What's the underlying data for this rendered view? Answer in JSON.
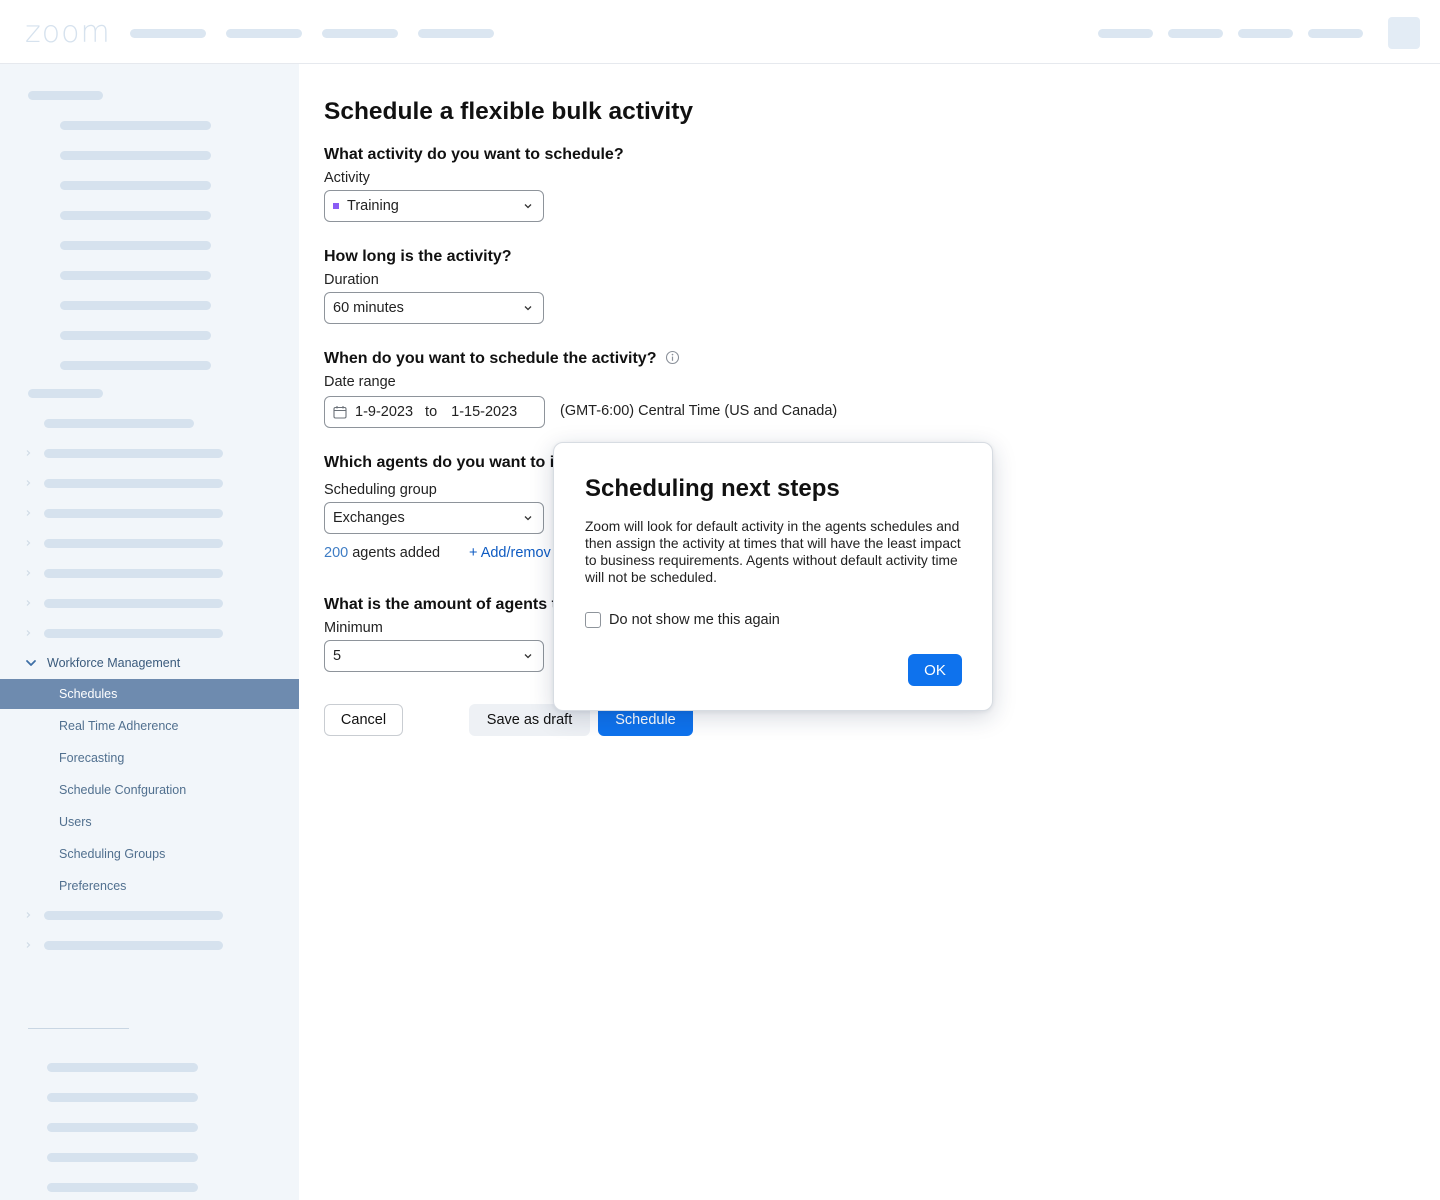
{
  "app": {
    "logo_text": "zoom"
  },
  "sidebar": {
    "section_title": "Workforce Management",
    "items": [
      {
        "label": "Schedules",
        "active": true
      },
      {
        "label": "Real Time Adherence",
        "active": false
      },
      {
        "label": "Forecasting",
        "active": false
      },
      {
        "label": "Schedule Confguration",
        "active": false
      },
      {
        "label": "Users",
        "active": false
      },
      {
        "label": "Scheduling Groups",
        "active": false
      },
      {
        "label": "Preferences",
        "active": false
      }
    ]
  },
  "form": {
    "title": "Schedule a flexible bulk activity",
    "activity": {
      "question": "What activity do you want to schedule?",
      "label": "Activity",
      "value": "Training",
      "swatch_color": "#8a5cf5"
    },
    "duration": {
      "question": "How long is the activity?",
      "label": "Duration",
      "value": "60 minutes"
    },
    "date": {
      "question": "When do you want to schedule the activity?",
      "label": "Date range",
      "start": "1-9-2023",
      "to": "to",
      "end": "1-15-2023",
      "timezone": "(GMT-6:00) Central Time (US and Canada)"
    },
    "agents": {
      "question": "Which agents do you want to in",
      "label": "Scheduling group",
      "value": "Exchanges",
      "count": "200",
      "count_text": "agents added",
      "add_remove": "+ Add/remov"
    },
    "amount": {
      "question": "What is the amount of agents t",
      "label": "Minimum",
      "value": "5"
    },
    "buttons": {
      "cancel": "Cancel",
      "save_draft": "Save as draft",
      "schedule": "Schedule"
    }
  },
  "modal": {
    "title": "Scheduling next steps",
    "body": "Zoom will look for default activity in the agents schedules and then assign the activity at times that will have the least impact to business requirements. Agents without default activity time will not be scheduled.",
    "checkbox_label": "Do not show me this again",
    "ok": "OK"
  },
  "colors": {
    "primary": "#0e72ed",
    "sidebar_bg": "#f2f6fa",
    "sidebar_active": "#6e8baf",
    "link": "#0e5bc2"
  }
}
